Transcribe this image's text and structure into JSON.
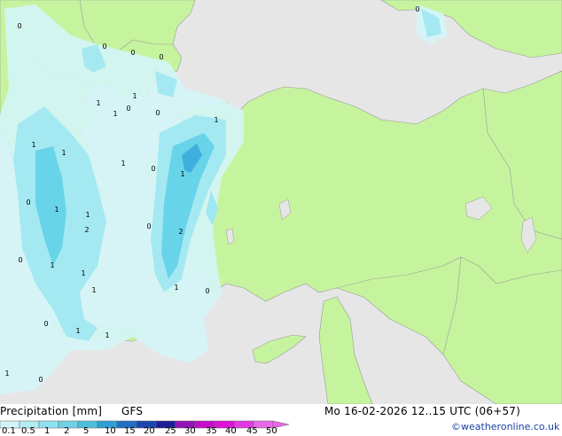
{
  "legend": {
    "title": "Precipitation [mm]",
    "model": "GFS",
    "ticks": [
      "0.1",
      "0.5",
      "1",
      "2",
      "5",
      "10",
      "15",
      "20",
      "25",
      "30",
      "35",
      "40",
      "45",
      "50"
    ],
    "colors": [
      "#d2f3f7",
      "#b2ebf3",
      "#8fe0ee",
      "#6fd1e6",
      "#4dbfdc",
      "#2e9fd2",
      "#1f6fc3",
      "#1a45b0",
      "#1b1e96",
      "#9313b8",
      "#c20ec8",
      "#dc12d6",
      "#e238e2",
      "#e866e8"
    ]
  },
  "datetime": "Mo 16-02-2026 12..15 UTC (06+57)",
  "credit": "©weatheronline.co.uk",
  "map_labels": [
    "0",
    "0",
    "0",
    "0",
    "1",
    "1",
    "1",
    "0",
    "0",
    "1",
    "1",
    "1",
    "1",
    "1",
    "0",
    "1",
    "2",
    "0",
    "0",
    "1",
    "1",
    "2",
    "0",
    "1",
    "1",
    "0",
    "1",
    "1",
    "0",
    "1",
    "0",
    "0",
    "1"
  ],
  "colors": {
    "sea": "#e6e6e6",
    "land": "#c6f49e",
    "border": "#999999",
    "light_precip": "#d4f5f7",
    "mid_precip": "#9fe8f1",
    "strong_precip": "#62d2e8",
    "heavy_precip": "#3aa8dc"
  }
}
